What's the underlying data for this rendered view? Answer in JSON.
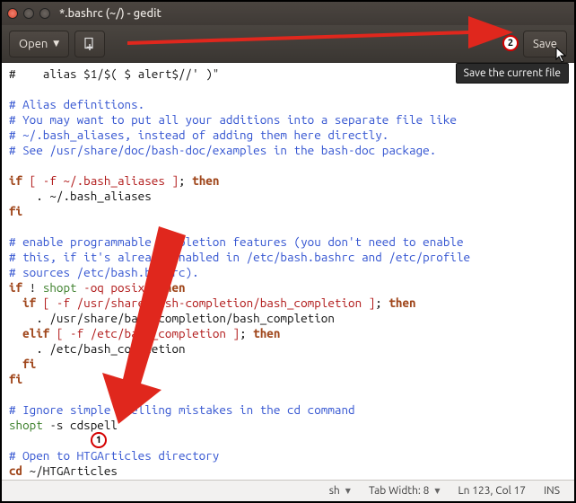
{
  "window": {
    "title": "*.bashrc (~/) - gedit"
  },
  "toolbar": {
    "open_label": "Open",
    "new_tooltip": "Create a new document",
    "save_label": "Save"
  },
  "tooltip": "Save the current file",
  "markers": {
    "m1": "1",
    "m2": "2"
  },
  "statusbar": {
    "lang": "sh",
    "tabwidth": "Tab Width: 8",
    "position": "Ln 123, Col 17",
    "mode": "INS"
  },
  "code": {
    "l1": "#    alias $1/$( $ alert$//' )\"",
    "l2": "",
    "l3": "# Alias definitions.",
    "l4": "# You may want to put all your additions into a separate file like",
    "l5": "# ~/.bash_aliases, instead of adding them here directly.",
    "l6": "# See /usr/share/doc/bash-doc/examples in the bash-doc package.",
    "l7": "",
    "l8a": "if",
    "l8b": " [ -f ~/.bash_aliases ]",
    "l8c": ";",
    "l8d": " then",
    "l9": "    . ~/.bash_aliases",
    "l10": "fi",
    "l11": "",
    "l12": "# enable programmable completion features (you don't need to enable",
    "l13": "# this, if it's already enabled in /etc/bash.bashrc and /etc/profile",
    "l14": "# sources /etc/bash.bashrc).",
    "l15a": "if",
    "l15b": " ! ",
    "l15c": "shopt",
    "l15d": " -oq posix",
    "l15e": ";",
    "l15f": " then",
    "l16a": "  if",
    "l16b": " [ -f /usr/share/bash-completion/bash_completion ]",
    "l16c": ";",
    "l16d": " then",
    "l17": "    . /usr/share/bash-completion/bash_completion",
    "l18a": "  elif",
    "l18b": " [ -f /etc/bash_completion ]",
    "l18c": ";",
    "l18d": " then",
    "l19": "    . /etc/bash_completion",
    "l20": "  fi",
    "l21": "fi",
    "l22": "",
    "l23": "# Ignore simple spelling mistakes in the cd command",
    "l24a": "shopt",
    "l24b": " -s cdspell",
    "l25": "",
    "l26": "# Open to HTGArticles directory",
    "l27a": "cd",
    "l27b": " ~/HTGArticles"
  }
}
